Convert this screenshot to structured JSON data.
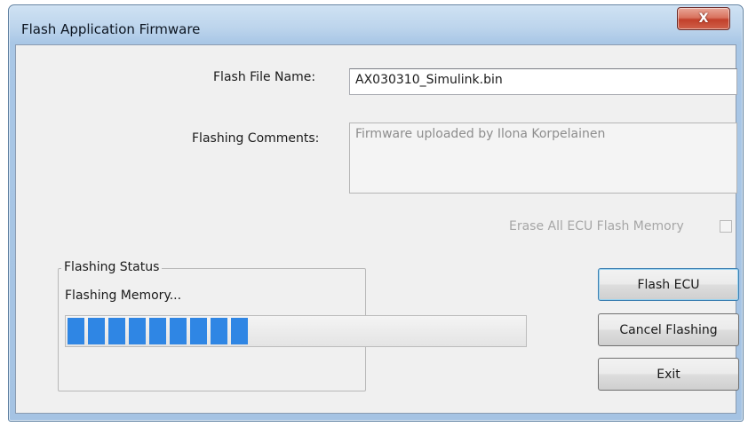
{
  "window": {
    "title": "Flash Application Firmware",
    "close_glyph": "X"
  },
  "form": {
    "file_name_label": "Flash File Name:",
    "file_name_value": "AX030310_Simulink.bin",
    "comments_label": "Flashing Comments:",
    "comments_value": "Firmware uploaded by Ilona Korpelainen",
    "erase_label": "Erase All ECU Flash Memory",
    "erase_checked": false
  },
  "status": {
    "group_title": "Flashing Status",
    "message": "Flashing Memory...",
    "progress_percent": 40,
    "progress_color": "#2f86e4"
  },
  "buttons": {
    "flash": "Flash ECU",
    "cancel": "Cancel Flashing",
    "exit": "Exit"
  },
  "icons": {
    "close": "close-icon"
  }
}
